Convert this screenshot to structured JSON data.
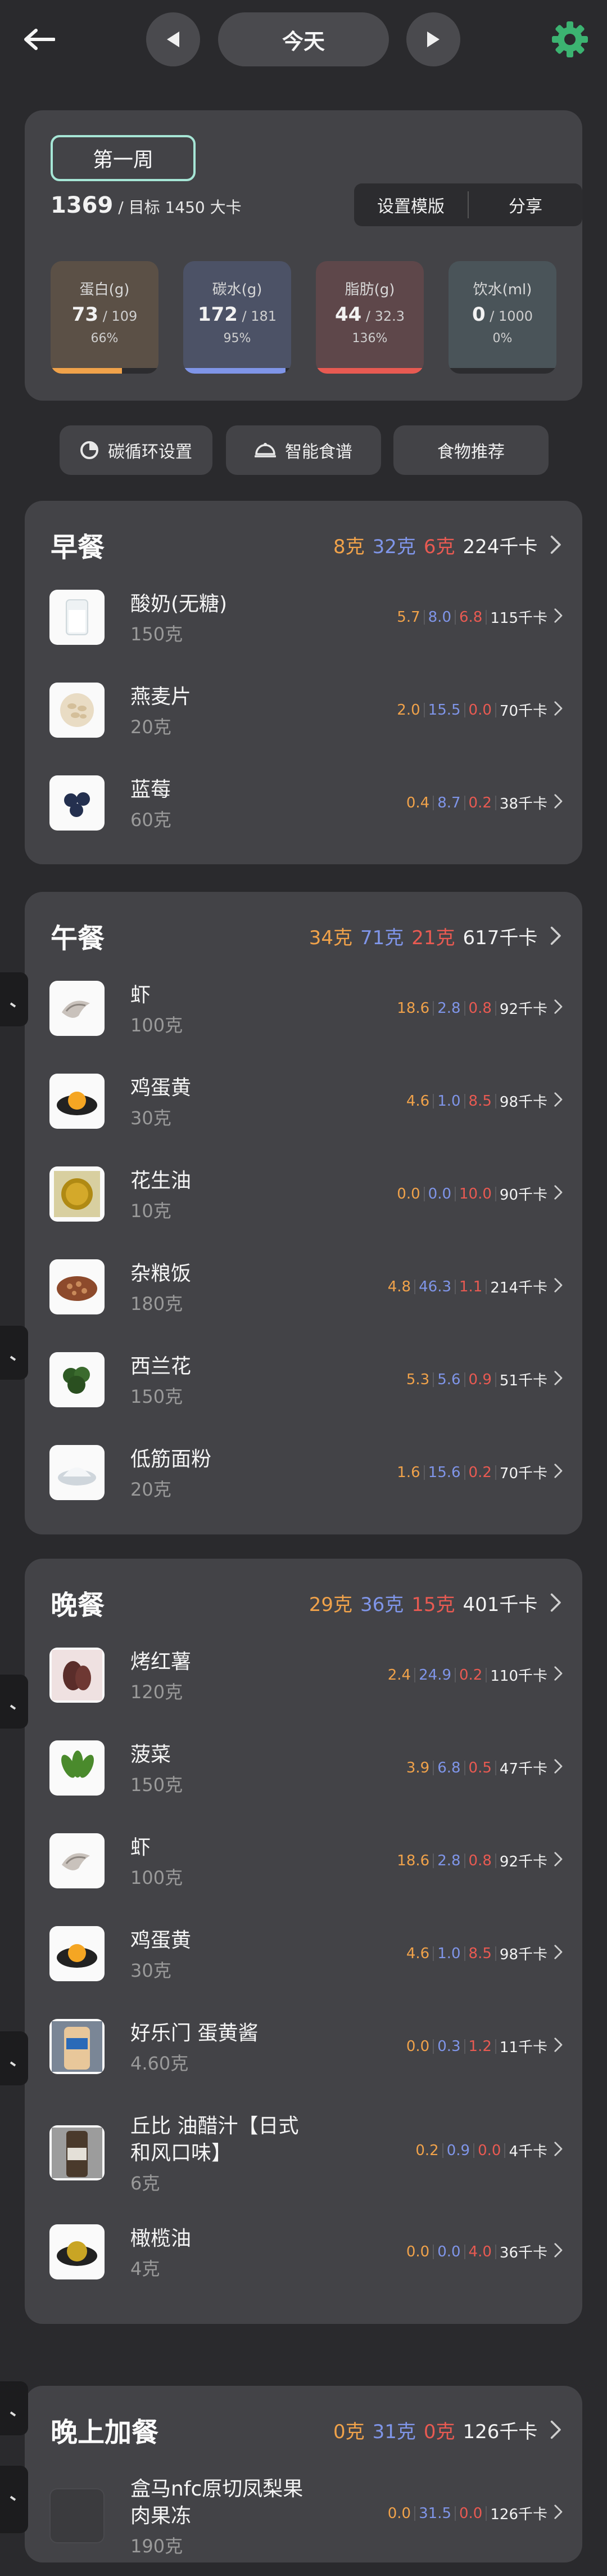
{
  "header": {
    "date_label": "今天",
    "back_icon": "arrow-left-icon",
    "prev_icon": "triangle-left-icon",
    "next_icon": "triangle-right-icon",
    "settings_icon": "gear-icon",
    "settings_color": "#3cb371"
  },
  "summary": {
    "week_label": "第一周",
    "calories": "1369",
    "target_text": " / 目标 1450 大卡",
    "template_button": "设置模版",
    "share_button": "分享",
    "stats": [
      {
        "label": "蛋白(g)",
        "value": "73",
        "target": " / 109",
        "percent": "66%",
        "progress": 0.66,
        "color": "#f0a24a",
        "bg": "#5b5046"
      },
      {
        "label": "碳水(g)",
        "value": "172",
        "target": " / 181",
        "percent": "95%",
        "progress": 0.95,
        "color": "#7f95e8",
        "bg": "#4c5266"
      },
      {
        "label": "脂肪(g)",
        "value": "44",
        "target": " / 32.3",
        "percent": "136%",
        "progress": 1.0,
        "color": "#e85a52",
        "bg": "#5e474a"
      },
      {
        "label": "饮水(ml)",
        "value": "0",
        "target": " / 1000",
        "percent": "0%",
        "progress": 0.0,
        "color": "#5fb0e8",
        "bg": "#4a5459"
      }
    ]
  },
  "chips": {
    "carb_cycle": "碳循环设置",
    "smart_recipe": "智能食谱",
    "food_recommend": "食物推荐"
  },
  "colors": {
    "protein": "#f0a24a",
    "carb": "#7f95e8",
    "fat": "#e85a52",
    "accent_week": "#a6e6d6"
  },
  "meals": [
    {
      "title": "早餐",
      "protein": "8克",
      "carb": "32克",
      "fat": "6克",
      "kcal": "224千卡",
      "items": [
        {
          "name": "酸奶(无糖)",
          "amount": "150克",
          "p": "5.7",
          "c": "8.0",
          "f": "6.8",
          "kcal": "115千卡",
          "icon": "yogurt-icon"
        },
        {
          "name": "燕麦片",
          "amount": "20克",
          "p": "2.0",
          "c": "15.5",
          "f": "0.0",
          "kcal": "70千卡",
          "icon": "oats-icon"
        },
        {
          "name": "蓝莓",
          "amount": "60克",
          "p": "0.4",
          "c": "8.7",
          "f": "0.2",
          "kcal": "38千卡",
          "icon": "blueberry-icon"
        }
      ]
    },
    {
      "title": "午餐",
      "protein": "34克",
      "carb": "71克",
      "fat": "21克",
      "kcal": "617千卡",
      "items": [
        {
          "name": "虾",
          "amount": "100克",
          "p": "18.6",
          "c": "2.8",
          "f": "0.8",
          "kcal": "92千卡",
          "icon": "shrimp-icon"
        },
        {
          "name": "鸡蛋黄",
          "amount": "30克",
          "p": "4.6",
          "c": "1.0",
          "f": "8.5",
          "kcal": "98千卡",
          "icon": "egg-yolk-icon"
        },
        {
          "name": "花生油",
          "amount": "10克",
          "p": "0.0",
          "c": "0.0",
          "f": "10.0",
          "kcal": "90千卡",
          "icon": "oil-icon"
        },
        {
          "name": "杂粮饭",
          "amount": "180克",
          "p": "4.8",
          "c": "46.3",
          "f": "1.1",
          "kcal": "214千卡",
          "icon": "grain-rice-icon"
        },
        {
          "name": "西兰花",
          "amount": "150克",
          "p": "5.3",
          "c": "5.6",
          "f": "0.9",
          "kcal": "51千卡",
          "icon": "broccoli-icon"
        },
        {
          "name": "低筋面粉",
          "amount": "20克",
          "p": "1.6",
          "c": "15.6",
          "f": "0.2",
          "kcal": "70千卡",
          "icon": "flour-icon"
        }
      ]
    },
    {
      "title": "晚餐",
      "protein": "29克",
      "carb": "36克",
      "fat": "15克",
      "kcal": "401千卡",
      "items": [
        {
          "name": "烤红薯",
          "amount": "120克",
          "p": "2.4",
          "c": "24.9",
          "f": "0.2",
          "kcal": "110千卡",
          "icon": "sweet-potato-icon"
        },
        {
          "name": "菠菜",
          "amount": "150克",
          "p": "3.9",
          "c": "6.8",
          "f": "0.5",
          "kcal": "47千卡",
          "icon": "spinach-icon"
        },
        {
          "name": "虾",
          "amount": "100克",
          "p": "18.6",
          "c": "2.8",
          "f": "0.8",
          "kcal": "92千卡",
          "icon": "shrimp-icon"
        },
        {
          "name": "鸡蛋黄",
          "amount": "30克",
          "p": "4.6",
          "c": "1.0",
          "f": "8.5",
          "kcal": "98千卡",
          "icon": "egg-yolk-icon"
        },
        {
          "name": "好乐门 蛋黄酱",
          "amount": "4.60克",
          "p": "0.0",
          "c": "0.3",
          "f": "1.2",
          "kcal": "11千卡",
          "icon": "mayonnaise-icon"
        },
        {
          "name": "丘比 油醋汁【日式",
          "name2": "和风口味】",
          "amount": "6克",
          "p": "0.2",
          "c": "0.9",
          "f": "0.0",
          "kcal": "4千卡",
          "icon": "vinaigrette-icon"
        },
        {
          "name": "橄榄油",
          "amount": "4克",
          "p": "0.0",
          "c": "0.0",
          "f": "4.0",
          "kcal": "36千卡",
          "icon": "olive-oil-icon"
        }
      ]
    },
    {
      "title": "晚上加餐",
      "protein": "0克",
      "carb": "31克",
      "fat": "0克",
      "kcal": "126千卡",
      "items": [
        {
          "name": "盒马nfc原切凤梨果",
          "name2": "肉果冻",
          "amount": "190克",
          "p": "0.0",
          "c": "31.5",
          "f": "0.0",
          "kcal": "126千卡",
          "icon": "pineapple-jelly-icon"
        }
      ]
    }
  ]
}
